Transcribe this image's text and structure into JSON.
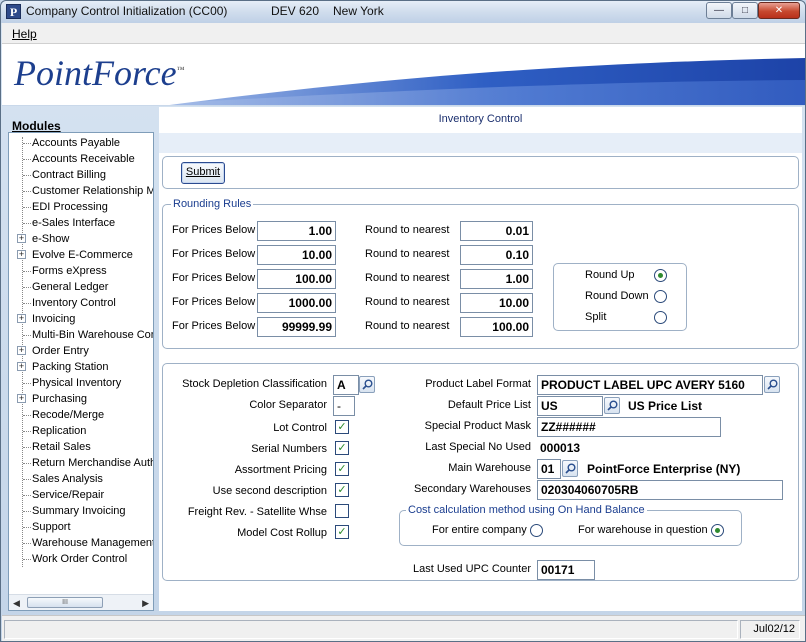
{
  "window": {
    "title": "Company Control Initialization (CC00)",
    "environment": "DEV 620",
    "location": "New York",
    "app_icon_letter": "P",
    "minimize_glyph": "—",
    "maximize_glyph": "□",
    "close_glyph": "✕"
  },
  "menu": {
    "help": "Help"
  },
  "brand": {
    "name": "PointForce",
    "tm": "™"
  },
  "sidebar": {
    "title": "Modules",
    "items": [
      {
        "label": "Accounts Payable",
        "expandable": false
      },
      {
        "label": "Accounts Receivable",
        "expandable": false
      },
      {
        "label": "Contract Billing",
        "expandable": false
      },
      {
        "label": "Customer Relationship Mgmt",
        "expandable": false
      },
      {
        "label": "EDI Processing",
        "expandable": false
      },
      {
        "label": "e-Sales Interface",
        "expandable": false
      },
      {
        "label": "e-Show",
        "expandable": true
      },
      {
        "label": "Evolve E-Commerce",
        "expandable": true
      },
      {
        "label": "Forms eXpress",
        "expandable": false
      },
      {
        "label": "General Ledger",
        "expandable": false
      },
      {
        "label": "Inventory Control",
        "expandable": false
      },
      {
        "label": "Invoicing",
        "expandable": true
      },
      {
        "label": "Multi-Bin Warehouse Control",
        "expandable": false
      },
      {
        "label": "Order Entry",
        "expandable": true
      },
      {
        "label": "Packing Station",
        "expandable": true
      },
      {
        "label": "Physical Inventory",
        "expandable": false
      },
      {
        "label": "Purchasing",
        "expandable": true
      },
      {
        "label": "Recode/Merge",
        "expandable": false
      },
      {
        "label": "Replication",
        "expandable": false
      },
      {
        "label": "Retail Sales",
        "expandable": false
      },
      {
        "label": "Return Merchandise Authorization",
        "expandable": false
      },
      {
        "label": "Sales Analysis",
        "expandable": false
      },
      {
        "label": "Service/Repair",
        "expandable": false
      },
      {
        "label": "Summary Invoicing",
        "expandable": false
      },
      {
        "label": "Support",
        "expandable": false
      },
      {
        "label": "Warehouse Management",
        "expandable": false
      },
      {
        "label": "Work Order Control",
        "expandable": false
      }
    ],
    "expand_glyph": "+",
    "scroll_left": "◀",
    "scroll_right": "▶",
    "thumb_grip": "III"
  },
  "main": {
    "heading": "Inventory Control",
    "submit_label": "Submit",
    "rounding": {
      "legend": "Rounding Rules",
      "price_label": "For Prices Below",
      "round_label": "Round to nearest",
      "rows": [
        {
          "price": "1.00",
          "nearest": "0.01"
        },
        {
          "price": "10.00",
          "nearest": "0.10"
        },
        {
          "price": "100.00",
          "nearest": "1.00"
        },
        {
          "price": "1000.00",
          "nearest": "10.00"
        },
        {
          "price": "99999.99",
          "nearest": "100.00"
        }
      ],
      "modes": [
        {
          "label": "Round Up",
          "selected": true
        },
        {
          "label": "Round Down",
          "selected": false
        },
        {
          "label": "Split",
          "selected": false
        }
      ]
    },
    "settings": {
      "stock_depletion_label": "Stock Depletion Classification",
      "stock_depletion_value": "A",
      "color_separator_label": "Color Separator",
      "color_separator_value": "-",
      "checkboxes": [
        {
          "label": "Lot Control",
          "checked": true
        },
        {
          "label": "Serial Numbers",
          "checked": true
        },
        {
          "label": "Assortment Pricing",
          "checked": true
        },
        {
          "label": "Use second description",
          "checked": true
        },
        {
          "label": "Freight Rev. - Satellite Whse",
          "checked": false
        },
        {
          "label": "Model Cost Rollup",
          "checked": true
        }
      ],
      "check_glyph": "✓",
      "product_label_format_label": "Product Label Format",
      "product_label_format_value": "PRODUCT LABEL UPC AVERY 5160",
      "default_price_list_label": "Default Price List",
      "default_price_list_value": "US",
      "default_price_list_desc": "US Price List",
      "special_product_mask_label": "Special Product Mask",
      "special_product_mask_value": "ZZ######",
      "last_special_no_label": "Last Special No Used",
      "last_special_no_value": "000013",
      "main_warehouse_label": "Main Warehouse",
      "main_warehouse_value": "01",
      "main_warehouse_desc": "PointForce Enterprise (NY)",
      "secondary_warehouses_label": "Secondary Warehouses",
      "secondary_warehouses_value": "020304060705RB",
      "cost_calc": {
        "legend": "Cost calculation method using On Hand Balance",
        "options": [
          {
            "label": "For entire company",
            "selected": false
          },
          {
            "label": "For warehouse in question",
            "selected": true
          }
        ]
      },
      "last_upc_label": "Last Used UPC Counter",
      "last_upc_value": "00171"
    }
  },
  "status": {
    "date": "Jul02/12"
  }
}
